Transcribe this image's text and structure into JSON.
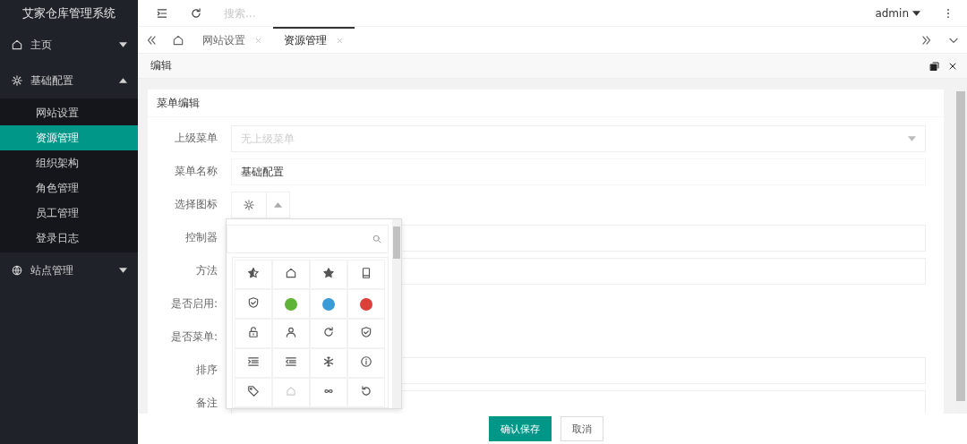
{
  "app_title": "艾家仓库管理系统",
  "sidebar": {
    "items": [
      {
        "label": "主页",
        "kind": "home",
        "expanded": false
      },
      {
        "label": "基础配置",
        "kind": "settings",
        "expanded": true,
        "children": [
          {
            "label": "网站设置",
            "selected": false
          },
          {
            "label": "资源管理",
            "selected": true
          },
          {
            "label": "组织架构",
            "selected": false
          },
          {
            "label": "角色管理",
            "selected": false
          },
          {
            "label": "员工管理",
            "selected": false
          },
          {
            "label": "登录日志",
            "selected": false
          }
        ]
      },
      {
        "label": "站点管理",
        "kind": "sites",
        "expanded": false
      }
    ]
  },
  "header": {
    "search": {
      "placeholder": "搜索..."
    },
    "user": "admin"
  },
  "tabs": {
    "items": [
      {
        "label": "网站设置",
        "selected": false
      },
      {
        "label": "资源管理",
        "selected": true
      }
    ]
  },
  "dialog": {
    "title": "编辑",
    "card_title": "菜单编辑",
    "fields": [
      {
        "label": "上级菜单",
        "kind": "select",
        "placeholder": "无上级菜单"
      },
      {
        "label": "菜单名称",
        "kind": "text",
        "value": "基础配置"
      },
      {
        "label": "选择图标",
        "kind": "icon-select"
      },
      {
        "label": "控制器",
        "kind": "input"
      },
      {
        "label": "方法",
        "kind": "input"
      },
      {
        "label": "是否启用:",
        "kind": "blank"
      },
      {
        "label": "是否菜单:",
        "kind": "blank"
      },
      {
        "label": "排序",
        "kind": "input"
      },
      {
        "label": "备注",
        "kind": "textarea"
      }
    ],
    "icon_picker": {
      "icons": [
        {
          "kind": "star-half"
        },
        {
          "kind": "home"
        },
        {
          "kind": "star"
        },
        {
          "kind": "tablet"
        },
        {
          "kind": "shield-check"
        },
        {
          "kind": "brand",
          "color": "#5fb336"
        },
        {
          "kind": "brand",
          "color": "#3b9bd6"
        },
        {
          "kind": "brand",
          "color": "#d9413a"
        },
        {
          "kind": "lock"
        },
        {
          "kind": "user"
        },
        {
          "kind": "refresh"
        },
        {
          "kind": "shield-check"
        },
        {
          "kind": "indent"
        },
        {
          "kind": "outdent"
        },
        {
          "kind": "snowflake"
        },
        {
          "kind": "info"
        },
        {
          "kind": "tag"
        },
        {
          "kind": "house"
        },
        {
          "kind": "infinity"
        },
        {
          "kind": "rotate"
        }
      ]
    },
    "buttons": [
      {
        "label": "确认保存",
        "kind": "primary"
      },
      {
        "label": "取消",
        "kind": "secondary"
      }
    ]
  }
}
